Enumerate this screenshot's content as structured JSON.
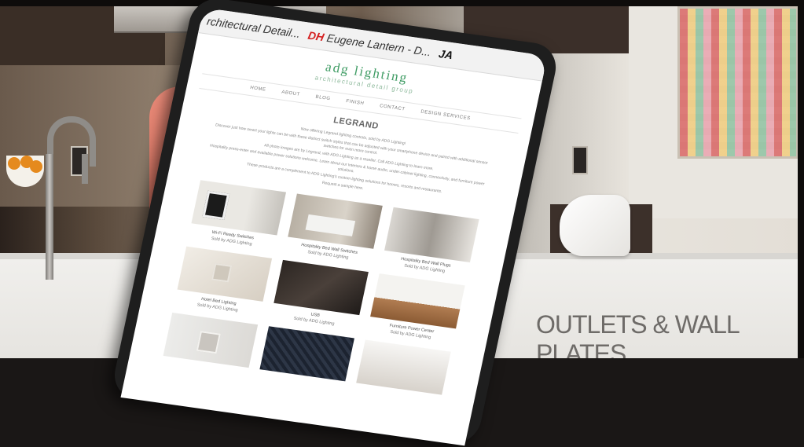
{
  "banner_caption": "OUTLETS & WALL PLATES",
  "browser": {
    "tabs": [
      {
        "icon": "",
        "label": "rchitectural Detail..."
      },
      {
        "icon": "DH",
        "label": "Eugene Lantern - D..."
      },
      {
        "icon": "JA",
        "label": ""
      }
    ]
  },
  "site": {
    "logo": "adg lighting",
    "tagline": "architectural detail group",
    "nav": [
      "HOME",
      "ABOUT",
      "BLOG",
      "FINISH",
      "CONTACT",
      "DESIGN SERVICES"
    ]
  },
  "page": {
    "title": "LEGRAND",
    "intro": [
      "Now offering Legrand lighting controls, sold by ADG Lighting!",
      "Discover just how smart your lights can be with these distinct switch styles that can be adjusted with your smartphone device and paired with additional sensor switches for even more control.",
      "All photo images are by Legrand, with ADG Lighting as a reseller. Call ADG Lighting to learn more.",
      "Hospitality press-enter and available power solutions welcome. Learn about our Interiors & home audio, under-cabinet lighting, connectivity, and furniture power solutions.",
      "These products are a complement to ADG Lighting's custom lighting solutions for homes, resorts and restaurants.",
      "Request a sample here."
    ],
    "products": [
      {
        "name": "Wi-Fi Ready Switches",
        "sold": "Sold by ADG Lighting"
      },
      {
        "name": "Hospitality Bed Wall Switches",
        "sold": "Sold by ADG Lighting"
      },
      {
        "name": "Hospitality Bed Wall Plugs",
        "sold": "Sold by ADG Lighting"
      },
      {
        "name": "Hotel Bed Lighting",
        "sold": "Sold by ADG Lighting"
      },
      {
        "name": "USB",
        "sold": "Sold by ADG Lighting"
      },
      {
        "name": "Furniture Power Center",
        "sold": "Sold by ADG Lighting"
      },
      {
        "name": "",
        "sold": ""
      },
      {
        "name": "",
        "sold": ""
      },
      {
        "name": "",
        "sold": ""
      }
    ]
  }
}
